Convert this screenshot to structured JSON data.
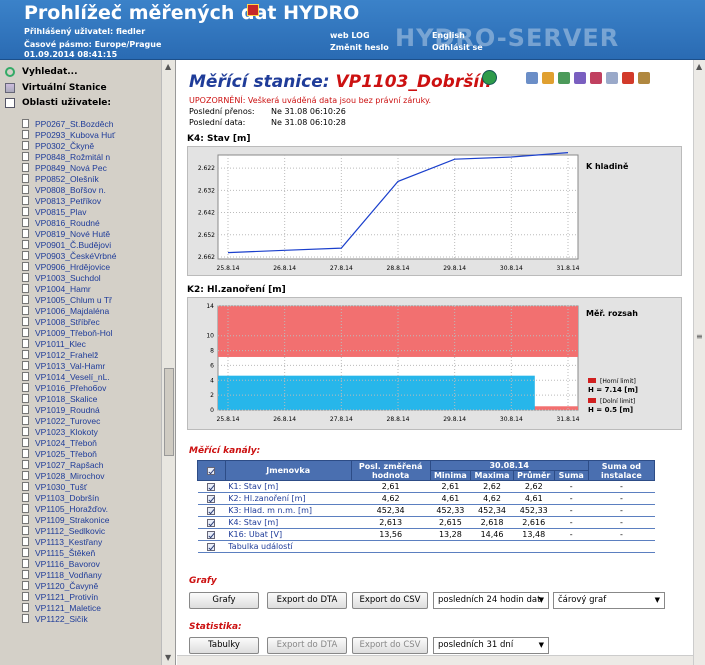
{
  "header": {
    "title": "Prohlížeč měřených dat HYDRO",
    "user_line": "Přihlášený uživatel: fiedler",
    "tz_line": "Časové pásmo: Europe/Prague",
    "datetime": "01.09.2014 08:41:15",
    "web_log": "web LOG",
    "change_password": "Změnit heslo",
    "english": "English",
    "logout": "Odhlásit se",
    "watermark": "HYDRO-SERVER"
  },
  "sidebar": {
    "search": "Vyhledat...",
    "virtual": "Virtuální Stanice",
    "areas": "Oblasti uživatele:",
    "stations": [
      "PP0267_St.Bozděch",
      "PP0293_Kubova Huť",
      "PP0302_Čkyně",
      "PP0848_Rožmitál n",
      "PP0849_Nová Pec",
      "PP0852_Olešník",
      "VP0808_Bořšov n.",
      "VP0813_Petříkov",
      "VP0815_Plav",
      "VP0816_Roudné",
      "VP0819_Nové Hutě",
      "VP0901_Č.Budějovi",
      "VP0903_ČeskéVrbné",
      "VP0906_Hrdějovice",
      "VP1003_Suchdol",
      "VP1004_Hamr",
      "VP1005_Chlum u Tř",
      "VP1006_Majdaléna",
      "VP1008_Stříbřec",
      "VP1009_Třeboň-Hol",
      "VP1011_Klec",
      "VP1012_Frahelž",
      "VP1013_Val-Hamr",
      "VP1014_Veselí_nL.",
      "VP1016_Přeho6ov",
      "VP1018_Skalice",
      "VP1019_Roudná",
      "VP1022_Turovec",
      "VP1023_Klokoty",
      "VP1024_Třeboň",
      "VP1025_Třeboň",
      "VP1027_Rapšach",
      "VP1028_Mirochov",
      "VP1030_Tušť",
      "VP1103_Dobršín",
      "VP1105_Horažďov.",
      "VP1109_Strakonice",
      "VP1112_Sedlkovic",
      "VP1113_Kestřany",
      "VP1115_Štěkeň",
      "VP1116_Bavorov",
      "VP1118_Vodňany",
      "VP1120_Čavyně",
      "VP1121_Protivín",
      "VP1121_Maletice",
      "VP1122_Sičík"
    ]
  },
  "main": {
    "title_prefix": "Měřící stanice: ",
    "station": "VP1103_Dobršín",
    "warning": "UPOZORNĚNÍ: Veškerá uváděná data jsou bez právní záruky.",
    "last_transfer_label": "Poslední přenos:",
    "last_transfer_value": "Ne 31.08 06:10:26",
    "last_data_label": "Poslední data:",
    "last_data_value": "Ne 31.08 06:10:28"
  },
  "charts": {
    "k4_label": "K4: Stav [m]",
    "k4_side": "K hladině",
    "k2_label": "K2: Hl.zanoření [m]",
    "k2_side": "Měř. rozsah",
    "k2_upper_name": "[Horní limit]",
    "k2_upper_value": "H = 7.14 [m]",
    "k2_lower_name": "[Dolní limit]",
    "k2_lower_value": "H = 0.5 [m]"
  },
  "chart_data": [
    {
      "type": "line",
      "title": "K4: Stav [m]",
      "x": [
        "25.8.14",
        "26.8.14",
        "27.8.14",
        "28.8.14",
        "29.8.14",
        "30.8.14",
        "31.8.14"
      ],
      "yticks": [
        "2.622",
        "2.632",
        "2.642",
        "2.652",
        "2.662"
      ],
      "ylim": [
        2.617,
        2.662
      ],
      "y_inverted": true,
      "series": [
        {
          "name": "K hladině",
          "color": "#1a3fcc",
          "y": [
            2.66,
            2.659,
            2.658,
            2.628,
            2.618,
            2.617,
            2.615
          ]
        }
      ]
    },
    {
      "type": "area",
      "title": "K2: Hl.zanoření [m]",
      "x": [
        "25.8.14",
        "26.8.14",
        "27.8.14",
        "28.8.14",
        "29.8.14",
        "30.8.14",
        "31.8.14"
      ],
      "yticks": [
        "0",
        "2",
        "4",
        "6",
        "8",
        "10",
        "14"
      ],
      "ylim": [
        0,
        14
      ],
      "upper_limit": 7.14,
      "lower_limit": 0.5,
      "series": [
        {
          "name": "Hl.zanoření",
          "color": "#27b6ea",
          "y": [
            4.62,
            4.62,
            4.62,
            4.62,
            4.62,
            4.62,
            4.62
          ]
        }
      ]
    }
  ],
  "channels": {
    "title": "Měřící kanály:",
    "headers": {
      "name": "Jmenovka",
      "last": "Posl. změřená hodnota",
      "date": "30.08.14",
      "min": "Minima",
      "max": "Maxima",
      "avg": "Průměr",
      "sum": "Suma",
      "sum_install": "Suma od instalace"
    },
    "rows": [
      {
        "name": "K1: Stav [m]",
        "last": "2,61",
        "min": "2,61",
        "max": "2,62",
        "avg": "2,62",
        "sum": "-",
        "sum_install": "-"
      },
      {
        "name": "K2: Hl.zanoření [m]",
        "last": "4,62",
        "min": "4,61",
        "max": "4,62",
        "avg": "4,61",
        "sum": "-",
        "sum_install": "-"
      },
      {
        "name": "K3: Hlad. m n.m. [m]",
        "last": "452,34",
        "min": "452,33",
        "max": "452,34",
        "avg": "452,33",
        "sum": "-",
        "sum_install": "-"
      },
      {
        "name": "K4: Stav [m]",
        "last": "2,613",
        "min": "2,615",
        "max": "2,618",
        "avg": "2,616",
        "sum": "-",
        "sum_install": "-"
      },
      {
        "name": "K16: Ubat [V]",
        "last": "13,56",
        "min": "13,28",
        "max": "14,46",
        "avg": "13,48",
        "sum": "-",
        "sum_install": "-"
      }
    ],
    "events": "Tabulka událostí"
  },
  "graphs": {
    "title": "Grafy",
    "btn_graphs": "Grafy",
    "btn_dta": "Export do DTA",
    "btn_csv": "Export do CSV",
    "range_select": "posledních 24 hodin dat",
    "type_select": "čárový graf"
  },
  "stats": {
    "title": "Statistika:",
    "btn_tables": "Tabulky",
    "btn_dta": "Export do DTA",
    "btn_csv": "Export do CSV",
    "range_select": "posledních 31 dní"
  }
}
